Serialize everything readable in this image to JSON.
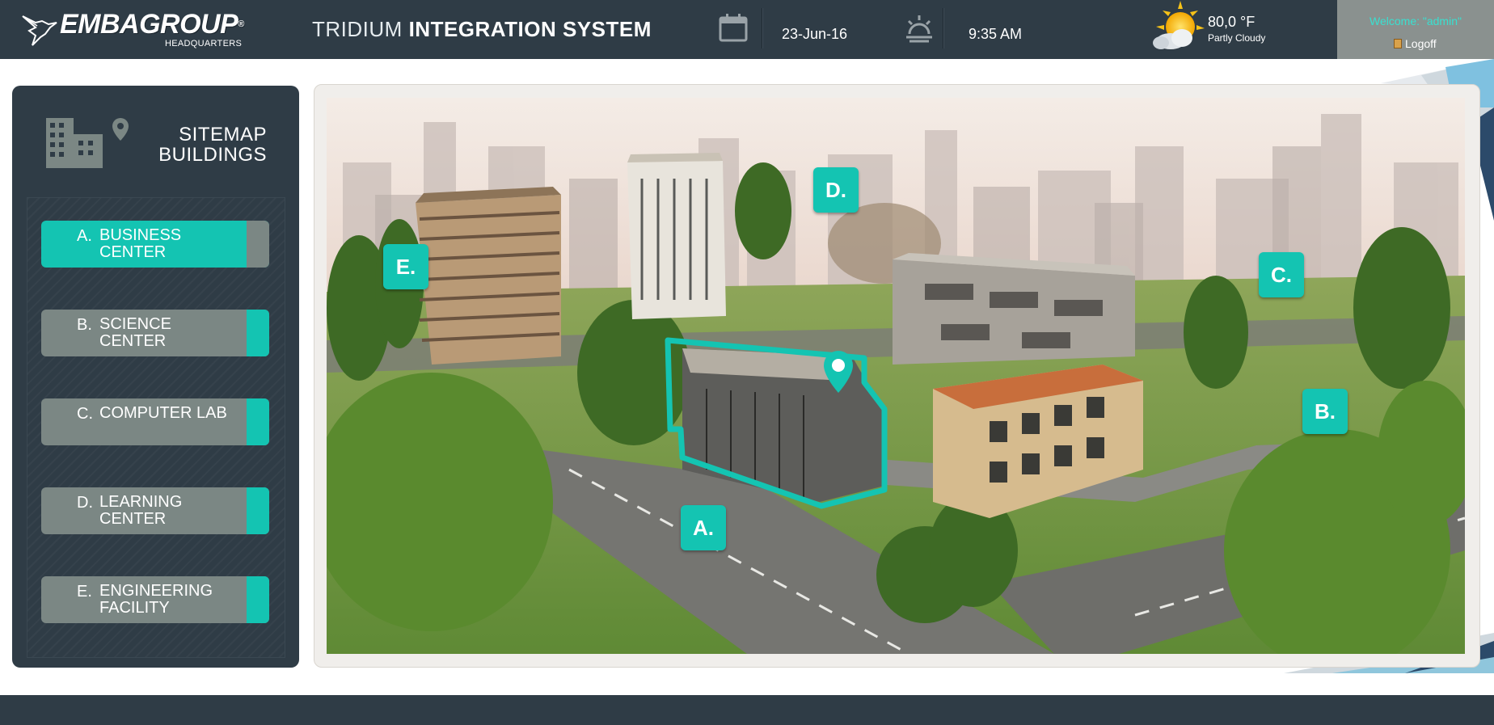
{
  "header": {
    "logo_name": "EMBAGROUP",
    "logo_sub": "HEADQUARTERS",
    "title_light": "TRIDIUM",
    "title_bold": "INTEGRATION SYSTEM",
    "date": "23-Jun-16",
    "time": "9:35 AM",
    "weather": {
      "temp": "80,0 °F",
      "desc": "Partly Cloudy",
      "icon": "partly-cloudy-icon"
    },
    "user": {
      "welcome": "Welcome: \"admin\"",
      "logoff": "Logoff"
    }
  },
  "sidebar": {
    "title_line1": "SITEMAP",
    "title_line2": "BUILDINGS",
    "buildings": [
      {
        "letter": "A.",
        "name": "BUSINESS CENTER",
        "active": true
      },
      {
        "letter": "B.",
        "name": "SCIENCE CENTER",
        "active": false
      },
      {
        "letter": "C.",
        "name": "COMPUTER LAB",
        "active": false
      },
      {
        "letter": "D.",
        "name": "LEARNING CENTER",
        "active": false
      },
      {
        "letter": "E.",
        "name": "ENGINEERING FACILITY",
        "active": false
      }
    ]
  },
  "map": {
    "markers": [
      "A.",
      "B.",
      "C.",
      "D.",
      "E."
    ]
  },
  "colors": {
    "header_bg": "#2f3c46",
    "accent": "#14c4b2",
    "button_gray": "#7b8784",
    "welcome_text": "#39e0d0"
  }
}
